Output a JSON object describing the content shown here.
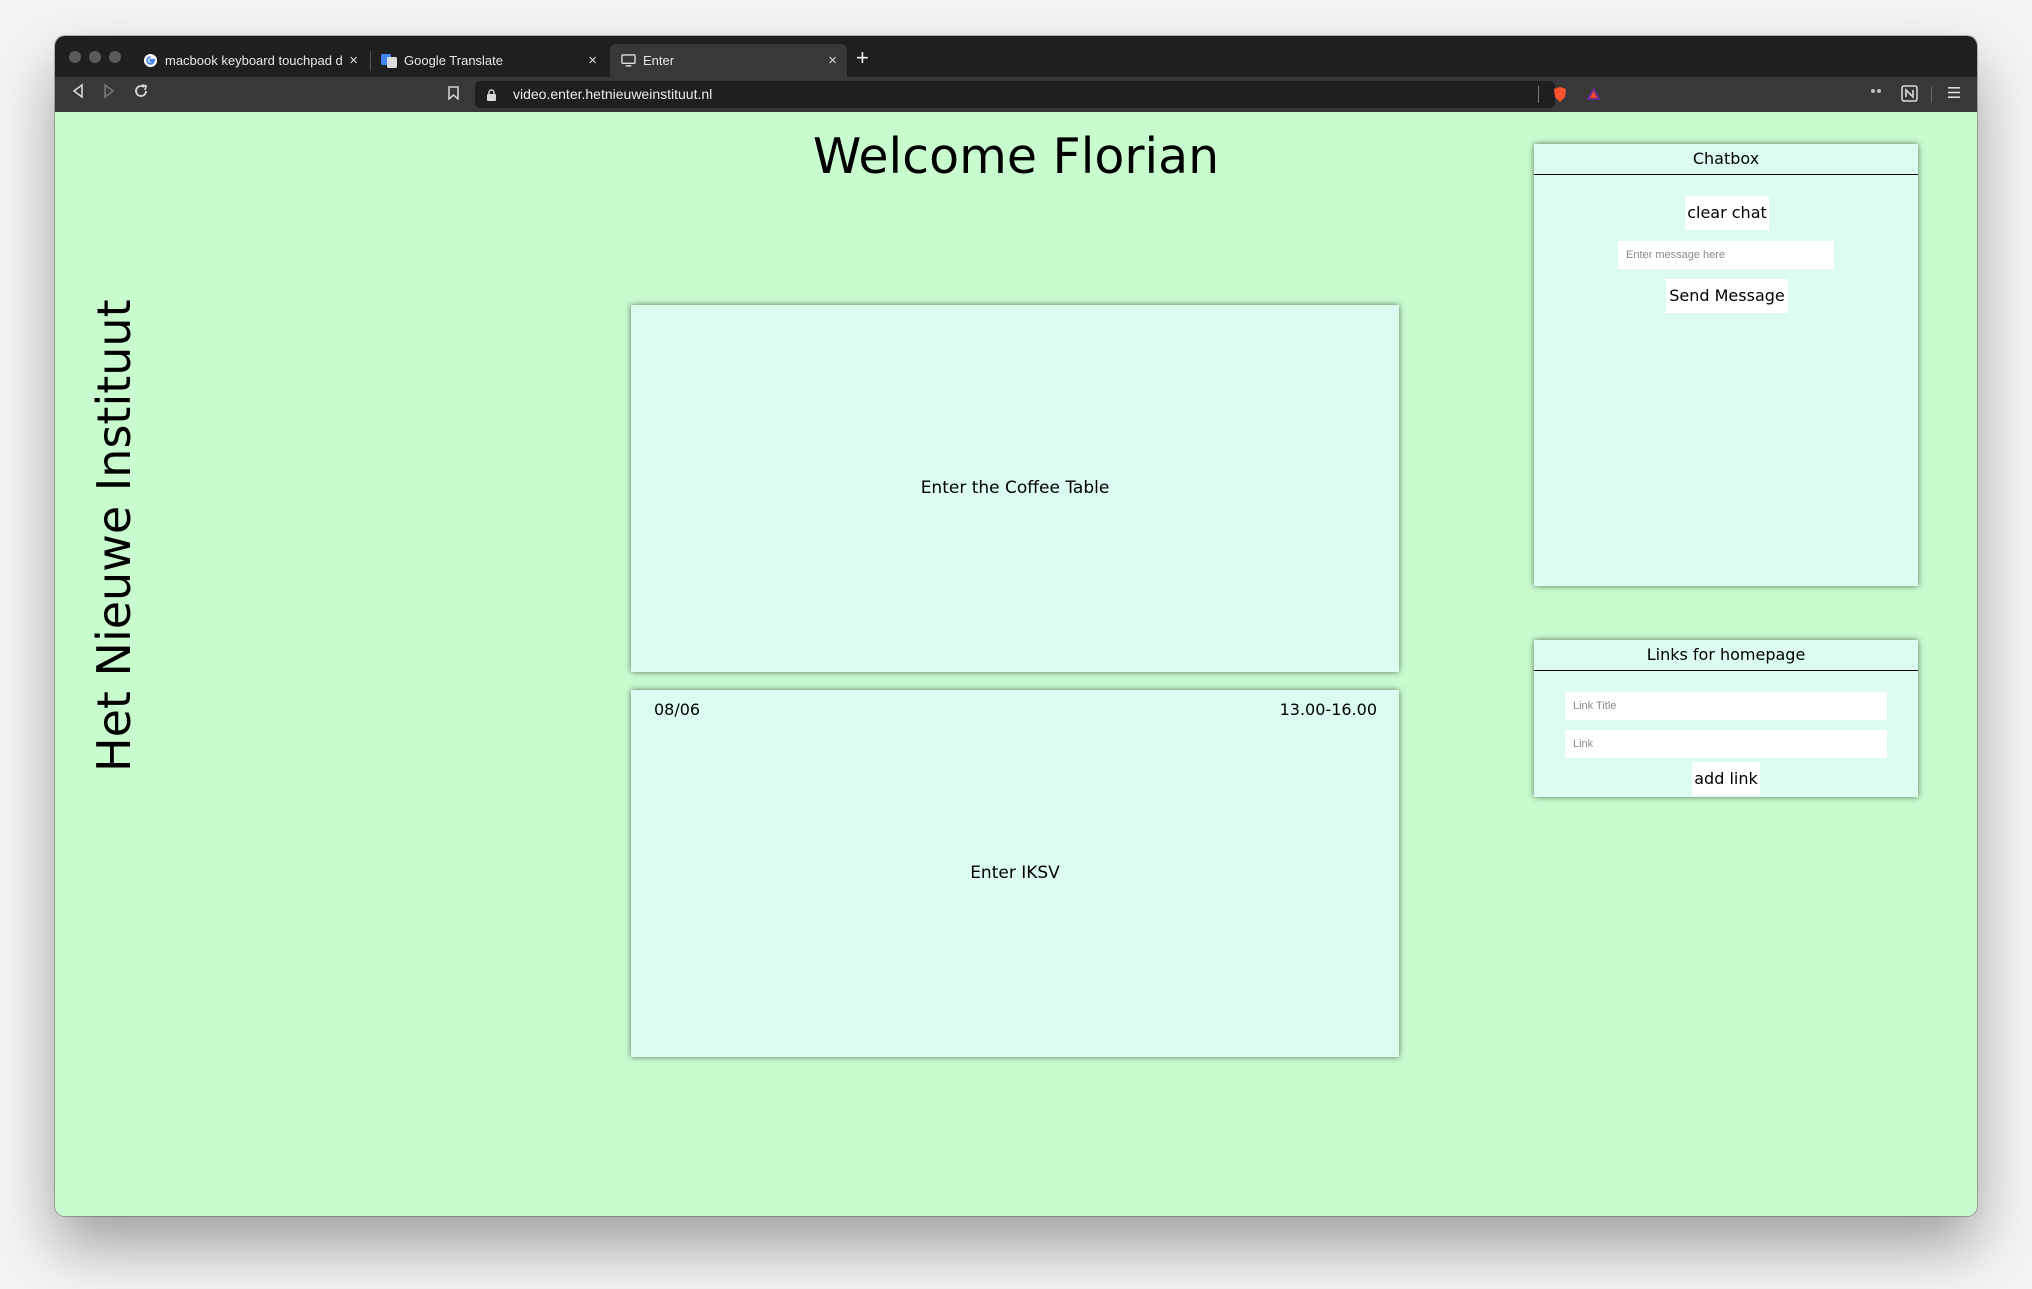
{
  "browser": {
    "tabs": [
      {
        "label": "macbook keyboard touchpad dp",
        "favicon": "google-icon"
      },
      {
        "label": "Google Translate",
        "favicon": "google-translate-icon"
      },
      {
        "label": "Enter",
        "favicon": "monitor-icon"
      }
    ],
    "close_glyph": "×",
    "new_tab_glyph": "+",
    "url": "video.enter.hetnieuweinstituut.nl"
  },
  "page": {
    "welcome": "Welcome Florian",
    "side_title": "Het Nieuwe Instituut",
    "rooms": [
      {
        "label": "Enter the Coffee Table",
        "date": "",
        "time": ""
      },
      {
        "label": "Enter IKSV",
        "date": "08/06",
        "time": "13.00-16.00"
      }
    ]
  },
  "chatbox": {
    "title": "Chatbox",
    "clear_label": "clear chat",
    "message_placeholder": "Enter message here",
    "send_label": "Send Message"
  },
  "links_panel": {
    "title": "Links for homepage",
    "title_placeholder": "Link Title",
    "link_placeholder": "Link",
    "add_label": "add link"
  },
  "colors": {
    "page_background": "#c8fccf",
    "card_background": "#dcfcf0",
    "browser_chrome": "#1f1f1f"
  }
}
